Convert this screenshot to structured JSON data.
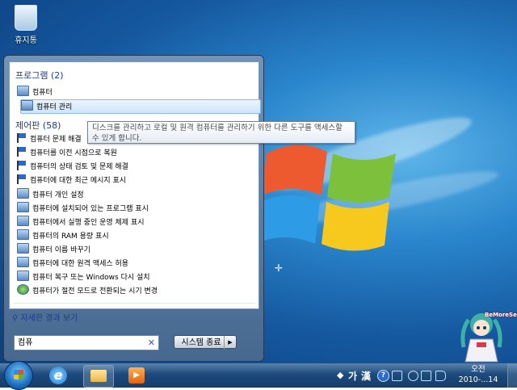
{
  "desktop": {
    "recycle_bin_label": "휴지통",
    "watermark": "BeMoreSee"
  },
  "start_menu": {
    "programs_header": "프로그램 (2)",
    "programs": [
      {
        "label": "컴퓨터",
        "icon": "computer-icon"
      },
      {
        "label": "컴퓨터 관리",
        "icon": "computer-management-icon",
        "highlighted": true
      }
    ],
    "control_panel_header": "제어판 (58)",
    "control_panel_items": [
      {
        "label": "컴퓨터 문제 해결",
        "icon": "flag-icon"
      },
      {
        "label": "컴퓨터를 이전 시점으로 복원",
        "icon": "flag-icon"
      },
      {
        "label": "컴퓨터의 상태 검토 및 문제 해결",
        "icon": "flag-icon"
      },
      {
        "label": "컴퓨터에 대한 최근 메시지 표시",
        "icon": "flag-icon"
      },
      {
        "label": "컴퓨터 개인 설정",
        "icon": "personalize-icon"
      },
      {
        "label": "컴퓨터에 설치되어 있는 프로그램 표시",
        "icon": "programs-icon"
      },
      {
        "label": "컴퓨터에서 실행 중인 운영 체제 표시",
        "icon": "system-icon"
      },
      {
        "label": "컴퓨터의 RAM 용량 표시",
        "icon": "system-icon"
      },
      {
        "label": "컴퓨터 이름 바꾸기",
        "icon": "system-icon"
      },
      {
        "label": "컴퓨터에 대한 원격 액세스 허용",
        "icon": "system-icon"
      },
      {
        "label": "컴퓨터 복구 또는 Windows 다시 설치",
        "icon": "recovery-icon"
      },
      {
        "label": "컴퓨터가 절전 모드로 전환되는 시기 변경",
        "icon": "power-icon"
      }
    ],
    "see_more": "자세한 결과 보기",
    "search_value": "컴퓨",
    "shutdown_label": "시스템 종료",
    "tooltip": "디스크를 관리하고 로컬 및 원격 컴퓨터를 관리하기 위한 다른 도구를 액세스할 수 있게 합니다."
  },
  "taskbar": {
    "ime_1": "가",
    "ime_2": "漢",
    "help": "?",
    "clock_line1": "오전",
    "clock_line2": "2010-...14"
  }
}
